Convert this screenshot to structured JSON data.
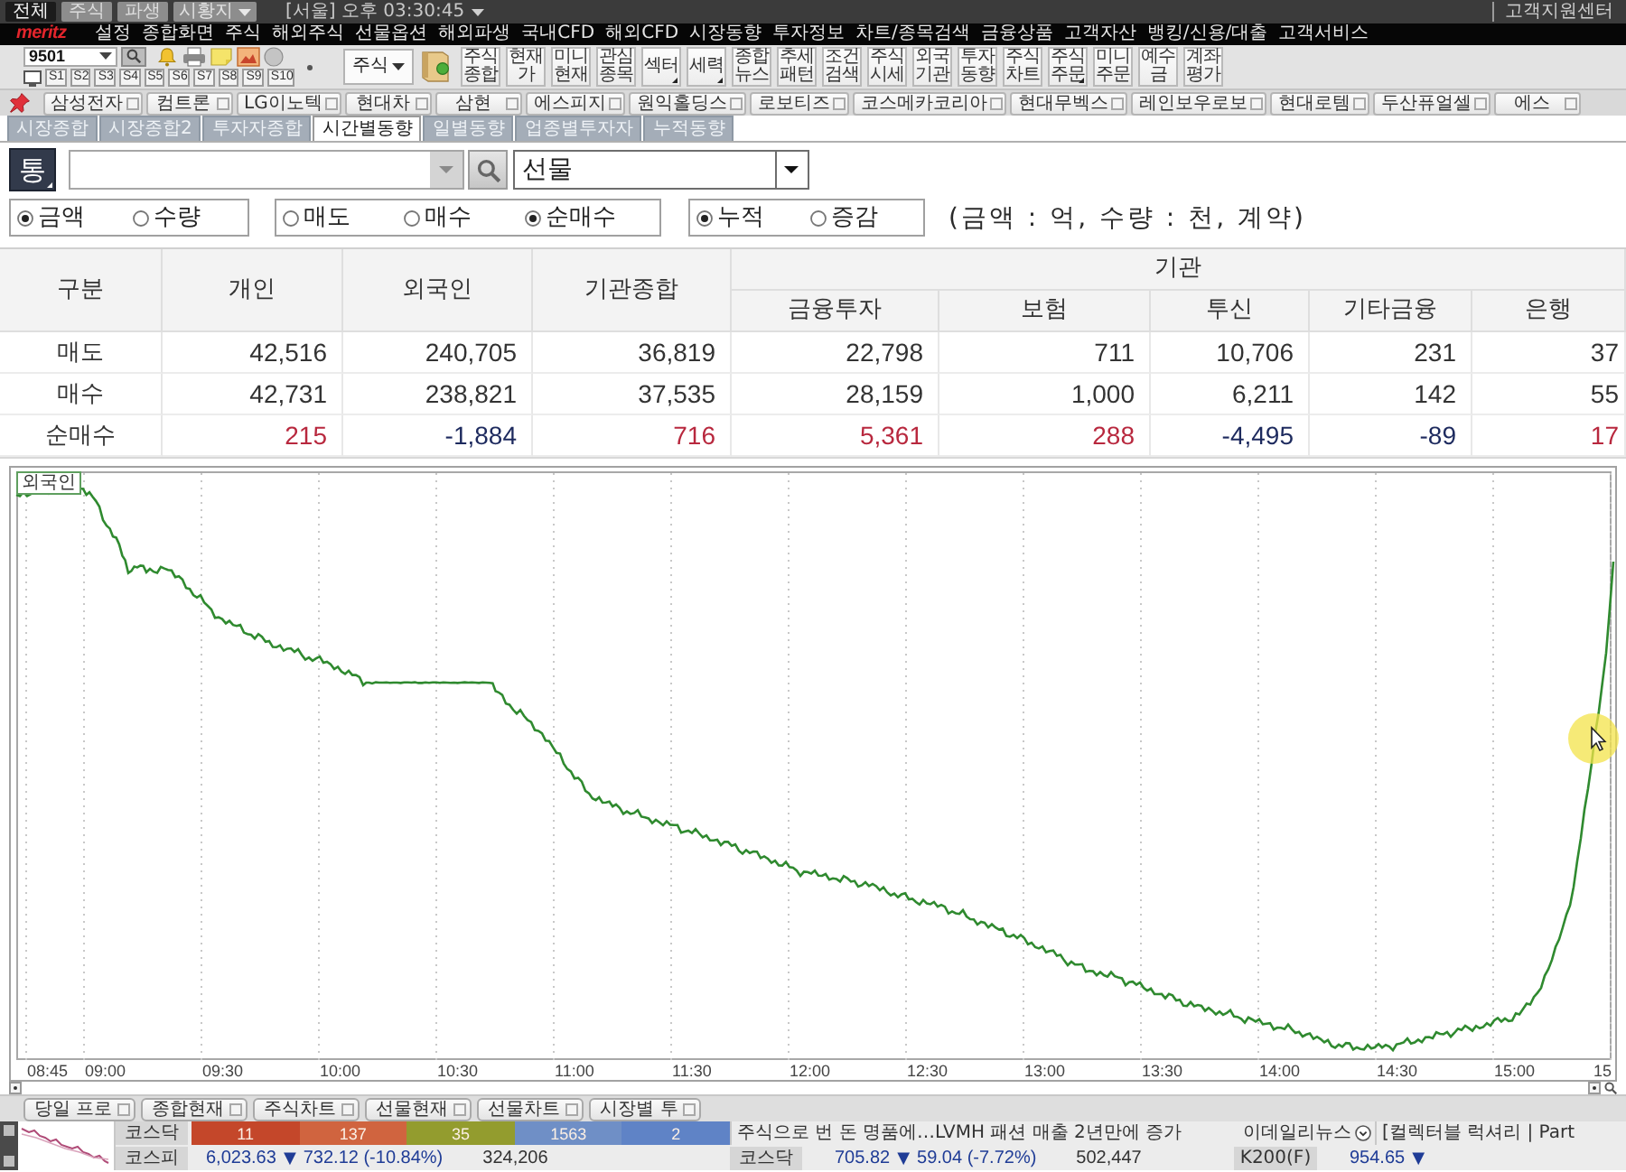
{
  "top_bar": {
    "tabs": [
      {
        "label": "전체",
        "selected": true
      },
      {
        "label": "주식",
        "selected": false
      },
      {
        "label": "파생",
        "selected": false
      }
    ],
    "dropdown": "시황지",
    "clock": "[서울] 오후 03:30:45",
    "support_link": "고객지원센터"
  },
  "menu_bar": {
    "logo": "meritz",
    "items": [
      "설정",
      "종합화면",
      "주식",
      "해외주식",
      "선물옵션",
      "해외파생",
      "국내CFD",
      "해외CFD",
      "시장동향",
      "투자정보",
      "차트/종목검색",
      "금융상품",
      "고객자산",
      "뱅킹/신용/대출",
      "고객서비스"
    ]
  },
  "toolbar": {
    "code": "9501",
    "slots": [
      "S1",
      "S2",
      "S3",
      "S4",
      "S5",
      "S6",
      "S7",
      "S8",
      "S9",
      "S10"
    ],
    "category": "주식",
    "buttons": [
      {
        "label": "주식\n종합",
        "has_menu": false
      },
      {
        "label": "현재\n가",
        "has_menu": false
      },
      {
        "label": "미니\n현재",
        "has_menu": false
      },
      {
        "label": "관심\n종목",
        "has_menu": false
      },
      {
        "label": "섹터",
        "has_menu": true
      },
      {
        "label": "세력",
        "has_menu": true
      },
      {
        "label": "종합\n뉴스",
        "has_menu": false
      },
      {
        "label": "추세\n패턴",
        "has_menu": false
      },
      {
        "label": "조건\n검색",
        "has_menu": false
      },
      {
        "label": "주식\n시세",
        "has_menu": false
      },
      {
        "label": "외국\n기관",
        "has_menu": false
      },
      {
        "label": "투자\n동향",
        "has_menu": false
      },
      {
        "label": "주식\n차트",
        "has_menu": false
      },
      {
        "label": "주식\n주문",
        "has_menu": true
      },
      {
        "label": "미니\n주문",
        "has_menu": false
      },
      {
        "label": "예수\n금",
        "has_menu": false
      },
      {
        "label": "계좌\n평가",
        "has_menu": false
      }
    ]
  },
  "favorites": [
    "삼성전자",
    "컴트론",
    "LG이노텍",
    "현대차",
    "삼현",
    "에스피지",
    "원익홀딩스",
    "로보티즈",
    "코스메카코리아",
    "현대무벡스",
    "레인보우로보",
    "현대로템",
    "두산퓨얼셀",
    "에스"
  ],
  "tabs": [
    {
      "label": "시장종합",
      "selected": false
    },
    {
      "label": "시장종합2",
      "selected": false
    },
    {
      "label": "투자자종합",
      "selected": false
    },
    {
      "label": "시간별동향",
      "selected": true
    },
    {
      "label": "일별동향",
      "selected": false
    },
    {
      "label": "업종별투자자",
      "selected": false
    },
    {
      "label": "누적동향",
      "selected": false
    }
  ],
  "query": {
    "market_button": "통",
    "code_field": {
      "disabled": true
    },
    "product": "선물"
  },
  "options": [
    {
      "items": [
        {
          "label": "금액",
          "selected": true
        },
        {
          "label": "수량",
          "selected": false
        }
      ]
    },
    {
      "items": [
        {
          "label": "매도",
          "selected": false
        },
        {
          "label": "매수",
          "selected": false
        },
        {
          "label": "순매수",
          "selected": true
        }
      ]
    },
    {
      "items": [
        {
          "label": "누적",
          "selected": true
        },
        {
          "label": "증감",
          "selected": false
        }
      ]
    }
  ],
  "units_note": "(금액 : 억, 수량 : 천, 계약)",
  "table": {
    "columns": [
      "구분",
      "개인",
      "외국인",
      "기관종합"
    ],
    "group": {
      "label": "기관",
      "columns": [
        "금융투자",
        "보험",
        "투신",
        "기타금융",
        "은행"
      ]
    },
    "rows": [
      {
        "cells": [
          {
            "text": "매도"
          },
          {
            "text": "42,516"
          },
          {
            "text": "240,705"
          },
          {
            "text": "36,819"
          },
          {
            "text": "22,798"
          },
          {
            "text": "711"
          },
          {
            "text": "10,706"
          },
          {
            "text": "231"
          },
          {
            "text": "37"
          }
        ]
      },
      {
        "cells": [
          {
            "text": "매수"
          },
          {
            "text": "42,731"
          },
          {
            "text": "238,821"
          },
          {
            "text": "37,535"
          },
          {
            "text": "28,159"
          },
          {
            "text": "1,000"
          },
          {
            "text": "6,211"
          },
          {
            "text": "142"
          },
          {
            "text": "55"
          }
        ]
      },
      {
        "cells": [
          {
            "text": "순매수"
          },
          {
            "text": "215",
            "positive": true
          },
          {
            "text": "-1,884",
            "positive": false
          },
          {
            "text": "716",
            "positive": true
          },
          {
            "text": "5,361",
            "positive": true
          },
          {
            "text": "288",
            "positive": true
          },
          {
            "text": "-4,495",
            "positive": false
          },
          {
            "text": "-89",
            "positive": false
          },
          {
            "text": "17",
            "positive": true
          }
        ]
      }
    ]
  },
  "chart": {
    "legend": "외국인",
    "x_labels": [
      "08:45",
      "09:00",
      "09:30",
      "10:00",
      "10:30",
      "11:00",
      "11:30",
      "12:00",
      "12:30",
      "13:00",
      "13:30",
      "14:00",
      "14:30",
      "15:00",
      "15"
    ]
  },
  "bottom_tabs": [
    "당일 프로",
    "종합현재",
    "주식차트",
    "선물현재",
    "선물차트",
    "시장별 투"
  ],
  "ticker": {
    "breadth": {
      "label": "코스닥",
      "segments": [
        {
          "text": "11",
          "color": "#c4472a"
        },
        {
          "text": "137",
          "color": "#d0643f"
        },
        {
          "text": "35",
          "color": "#939c2e"
        },
        {
          "text": "1563",
          "color": "#6f8fc6"
        },
        {
          "text": "2",
          "color": "#5f83c6"
        }
      ]
    },
    "news": {
      "headline": "주식으로 번 돈 명품에…LVMH 패션 매출 2년만에 증가",
      "source": "이데일리뉴스",
      "next": "[컬렉터블 럭셔리 | Part"
    },
    "quotes": [
      {
        "label": "코스피",
        "price": "6,023.63",
        "arrow": "▼",
        "change": "732.12 (-10.84%)",
        "volume": "324,206",
        "falling": true
      },
      {
        "label": "코스닥",
        "price": "705.82",
        "arrow": "▼",
        "change": "59.04 (-7.72%)",
        "volume": "502,447",
        "falling": true
      },
      {
        "label": "K200(F)",
        "price": "954.65",
        "arrow": "▼",
        "falling": true
      }
    ]
  }
}
